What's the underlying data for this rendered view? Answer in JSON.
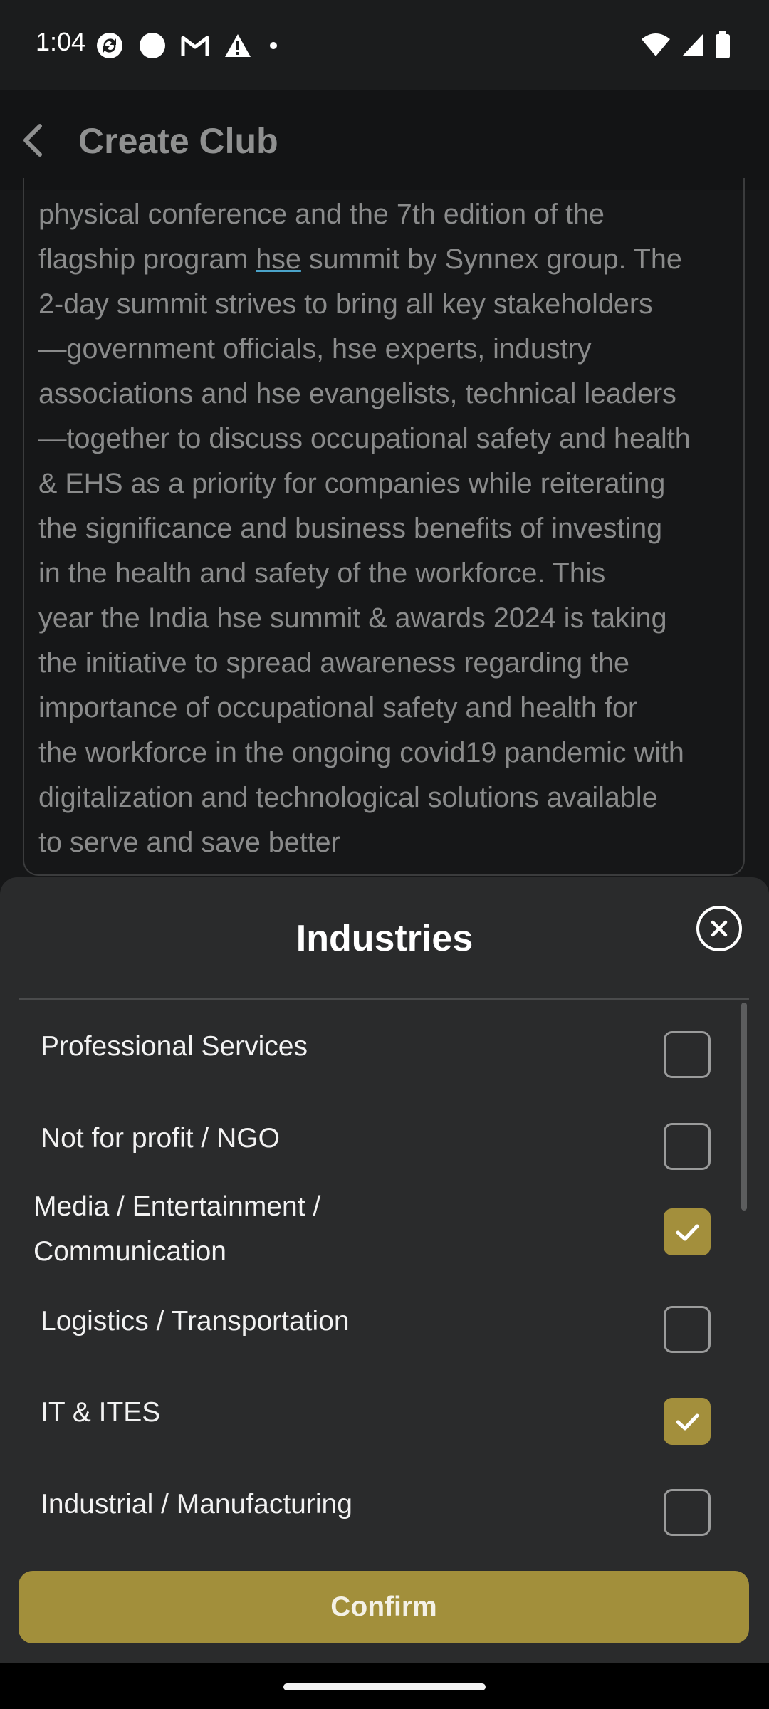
{
  "status_bar": {
    "time": "1:04",
    "left_icons": [
      "sync-icon",
      "circle-icon",
      "gmail-icon",
      "warning-icon",
      "dot-icon"
    ],
    "right_icons": [
      "wifi-icon",
      "signal-icon",
      "battery-icon"
    ]
  },
  "app_bar": {
    "title": "Create Club"
  },
  "description": {
    "before": "physical conference and the 7th edition of the\nflagship program ",
    "underlined": "hse",
    "after": " summit by Synnex group. The\n2-day summit strives to bring all key stakeholders\n—government officials, hse experts, industry\nassociations and hse evangelists, technical leaders\n—together to discuss occupational safety and health\n& EHS as a priority for companies while reiterating\nthe significance and business benefits of investing\nin the health and safety of the workforce. This\nyear the India hse summit & awards 2024 is taking\nthe initiative to spread awareness regarding the\nimportance of occupational safety and health for\nthe workforce in the ongoing covid19 pandemic with\ndigitalization and technological solutions available\nto serve and save better"
  },
  "sheet": {
    "title": "Industries",
    "confirm_label": "Confirm",
    "options": [
      {
        "label": "Professional Services",
        "checked": false
      },
      {
        "label": "Not for profit / NGO",
        "checked": false
      },
      {
        "label": " Media / Entertainment /\nCommunication",
        "checked": true
      },
      {
        "label": "Logistics / Transportation",
        "checked": false
      },
      {
        "label": "IT & ITES",
        "checked": true
      },
      {
        "label": "Industrial / Manufacturing",
        "checked": false
      }
    ]
  },
  "colors": {
    "accent": "#a28f3b",
    "sheet_bg": "#2a2b2c",
    "page_bg": "#161718"
  }
}
